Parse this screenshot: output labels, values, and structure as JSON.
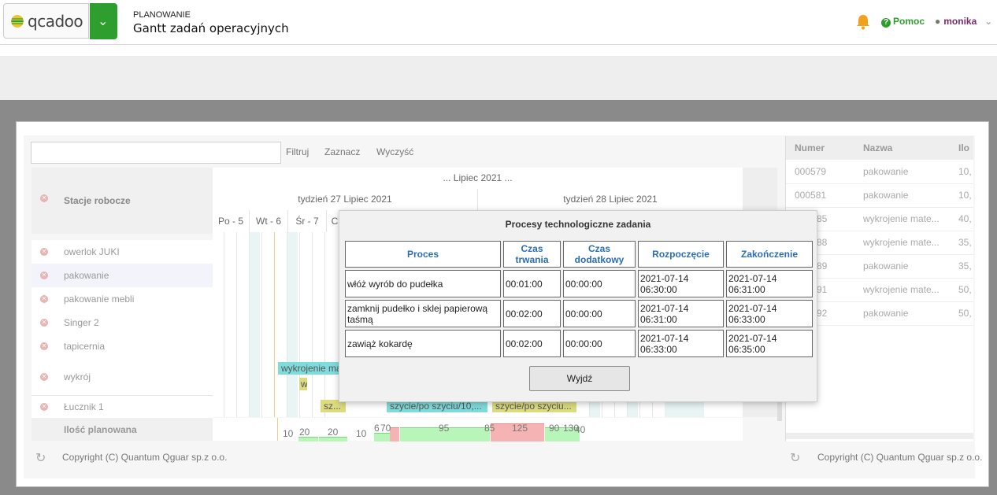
{
  "header": {
    "logo_text": "qcadoo",
    "section": "PLANOWANIE",
    "title": "Gantt zadań operacyjnych",
    "help_label": "Pomoc",
    "user_name": "monika",
    "icons": [
      "logo-icon",
      "menu-chevron-icon",
      "bell-icon",
      "help-icon",
      "user-icon",
      "chevron-down-icon"
    ]
  },
  "toolbar": {
    "search_placeholder": "",
    "filter_label": "Filtruj",
    "select_label": "Zaznacz",
    "clear_label": "Wyczyść"
  },
  "gantt": {
    "stations_header": "Stacje robocze",
    "month_label": "... Lipiec 2021 ...",
    "week1_label": "tydzień 27 Lipiec 2021",
    "week2_label": "tydzień 28 Lipiec 2021",
    "days": [
      "Po - 5",
      "Wt - 6",
      "Śr - 7",
      "C"
    ],
    "stations": [
      "owerlok JUKI",
      "pakowanie",
      "pakowanie mebli",
      "Singer 2",
      "tapicernia",
      "wykrój",
      "Łucznik 1"
    ],
    "qty_label": "Ilość planowana",
    "bars": [
      "wykrojenie ma",
      "w",
      "sz...",
      "szycie/po szyciu/10,...",
      "szycie/po szyciu..."
    ],
    "load_values": [
      "10",
      "20",
      "20",
      "10",
      "6",
      "70",
      "95",
      "85",
      "125",
      "90",
      "130",
      "40"
    ]
  },
  "right_table": {
    "columns": [
      "Numer",
      "Nazwa",
      "Ilo"
    ],
    "rows": [
      {
        "num": "000579",
        "name": "pakowanie",
        "qty": "10,"
      },
      {
        "num": "000581",
        "name": "pakowanie",
        "qty": "10,"
      },
      {
        "num": "85",
        "name": "wykrojenie mate...",
        "qty": "40,"
      },
      {
        "num": "88",
        "name": "wykrojenie mate...",
        "qty": "35,"
      },
      {
        "num": "89",
        "name": "pakowanie",
        "qty": "35,"
      },
      {
        "num": "91",
        "name": "wykrojenie mate...",
        "qty": "50,"
      },
      {
        "num": "92",
        "name": "pakowanie",
        "qty": "50,"
      }
    ]
  },
  "footer": {
    "copyright": "Copyright (C) Quantum Qguar sp.z o.o."
  },
  "modal": {
    "title": "Procesy technologiczne zadania",
    "headers": [
      "Proces",
      "Czas trwania",
      "Czas dodatkowy",
      "Rozpoczęcie",
      "Zakończenie"
    ],
    "rows": [
      {
        "proces": "włóż wyrób do pudełka",
        "czas": "00:01:00",
        "dodatkowy": "00:00:00",
        "start": "2021-07-14 06:30:00",
        "end": "2021-07-14 06:31:00"
      },
      {
        "proces": "zamknij pudełko i sklej papierową taśmą",
        "czas": "00:02:00",
        "dodatkowy": "00:00:00",
        "start": "2021-07-14 06:31:00",
        "end": "2021-07-14 06:33:00"
      },
      {
        "proces": "zawiąż kokardę",
        "czas": "00:02:00",
        "dodatkowy": "00:00:00",
        "start": "2021-07-14 06:33:00",
        "end": "2021-07-14 06:35:00"
      }
    ],
    "exit_label": "Wyjdź"
  }
}
